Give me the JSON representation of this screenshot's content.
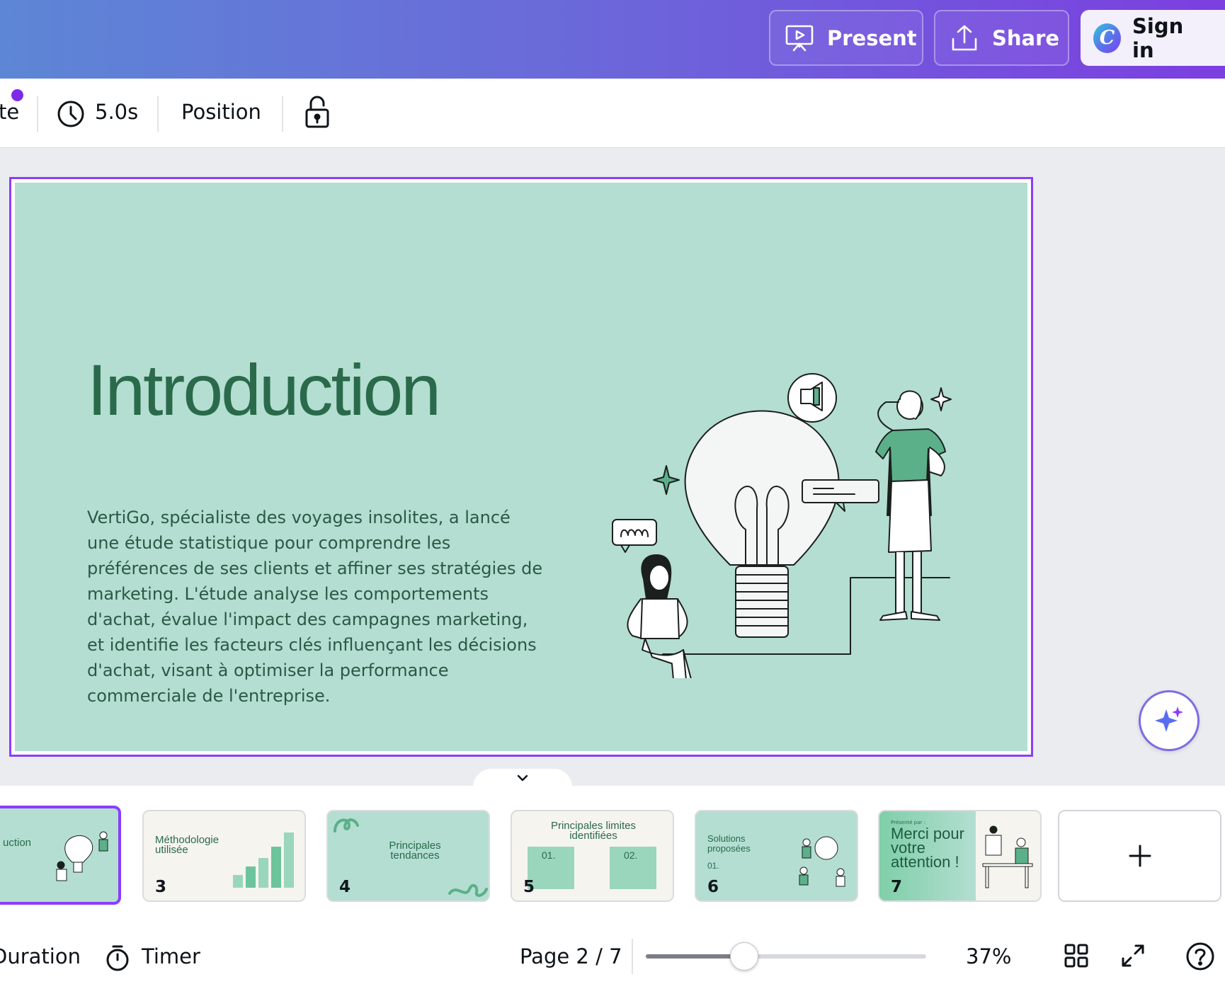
{
  "header": {
    "present_label": "Present",
    "share_label": "Share",
    "signin_label": "Sign in",
    "logo_letter": "C"
  },
  "toolbar": {
    "cut_label": "te",
    "duration_label": "5.0s",
    "position_label": "Position"
  },
  "slide": {
    "title": "Introduction",
    "body": "VertiGo, spécialiste des voyages insolites, a lancé une étude statistique pour comprendre les préférences de ses clients et affiner ses stratégies de marketing. L'étude analyse les comportements d'achat, évalue l'impact des campagnes marketing, et identifie les facteurs clés influençant les décisions d'achat, visant à optimiser la performance commerciale de l'entreprise."
  },
  "thumbnails": [
    {
      "num": "",
      "title": "uction"
    },
    {
      "num": "3",
      "title": "Méthodologie utilisée"
    },
    {
      "num": "4",
      "title": "Principales tendances"
    },
    {
      "num": "5",
      "title": "Principales limites identifiées",
      "col1": "01.",
      "col2": "02."
    },
    {
      "num": "6",
      "title": "Solutions proposées",
      "item": "01."
    },
    {
      "num": "7",
      "title": "Merci pour votre attention !",
      "kicker": "Présenté par :"
    }
  ],
  "footer": {
    "duration_label": "Duration",
    "timer_label": "Timer",
    "page_label": "Page 2 / 7",
    "zoom_label": "37%",
    "zoom_fraction": 0.35
  },
  "colors": {
    "accent": "#8b3dff",
    "slide_bg": "#b3ded1",
    "title_green": "#2a6a4b",
    "illustration_green": "#5bb08a"
  },
  "icons": [
    "present-icon",
    "share-icon",
    "canva-logo",
    "clock-icon",
    "lock-icon",
    "sparkle-icon",
    "chevron-down-icon",
    "plus-icon",
    "timer-icon",
    "grid-view-icon",
    "fullscreen-icon",
    "help-icon"
  ]
}
